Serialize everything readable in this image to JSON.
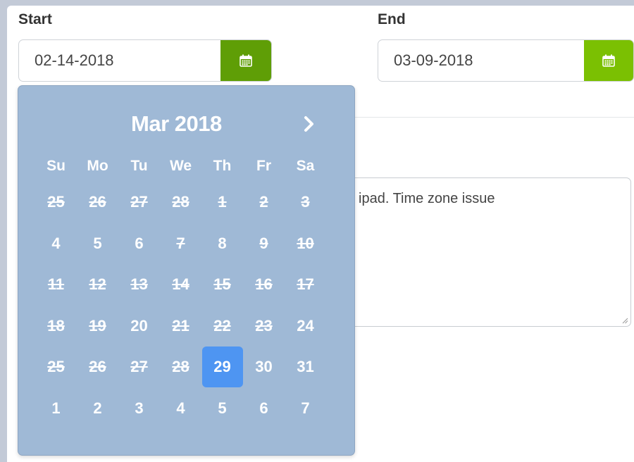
{
  "start": {
    "label": "Start",
    "value": "02-14-2018"
  },
  "end": {
    "label": "End",
    "value": "03-09-2018"
  },
  "notes": {
    "visible_text": "ipad. Time zone issue"
  },
  "datepicker": {
    "title": "Mar 2018",
    "weekdays": [
      "Su",
      "Mo",
      "Tu",
      "We",
      "Th",
      "Fr",
      "Sa"
    ],
    "weeks": [
      [
        {
          "d": "25",
          "disabled": true
        },
        {
          "d": "26",
          "disabled": true
        },
        {
          "d": "27",
          "disabled": true
        },
        {
          "d": "28",
          "disabled": true
        },
        {
          "d": "1",
          "disabled": true
        },
        {
          "d": "2",
          "disabled": true
        },
        {
          "d": "3",
          "disabled": true
        }
      ],
      [
        {
          "d": "4",
          "disabled": false
        },
        {
          "d": "5",
          "disabled": false
        },
        {
          "d": "6",
          "disabled": false
        },
        {
          "d": "7",
          "disabled": true
        },
        {
          "d": "8",
          "disabled": false
        },
        {
          "d": "9",
          "disabled": true
        },
        {
          "d": "10",
          "disabled": true
        }
      ],
      [
        {
          "d": "11",
          "disabled": true
        },
        {
          "d": "12",
          "disabled": true
        },
        {
          "d": "13",
          "disabled": true
        },
        {
          "d": "14",
          "disabled": true
        },
        {
          "d": "15",
          "disabled": true
        },
        {
          "d": "16",
          "disabled": true
        },
        {
          "d": "17",
          "disabled": true
        }
      ],
      [
        {
          "d": "18",
          "disabled": true
        },
        {
          "d": "19",
          "disabled": true
        },
        {
          "d": "20",
          "disabled": false
        },
        {
          "d": "21",
          "disabled": true
        },
        {
          "d": "22",
          "disabled": true
        },
        {
          "d": "23",
          "disabled": true
        },
        {
          "d": "24",
          "disabled": false
        }
      ],
      [
        {
          "d": "25",
          "disabled": true
        },
        {
          "d": "26",
          "disabled": true
        },
        {
          "d": "27",
          "disabled": true
        },
        {
          "d": "28",
          "disabled": true
        },
        {
          "d": "29",
          "disabled": false,
          "selected": true
        },
        {
          "d": "30",
          "disabled": false
        },
        {
          "d": "31",
          "disabled": false
        }
      ],
      [
        {
          "d": "1",
          "disabled": false
        },
        {
          "d": "2",
          "disabled": false
        },
        {
          "d": "3",
          "disabled": false
        },
        {
          "d": "4",
          "disabled": false
        },
        {
          "d": "5",
          "disabled": false
        },
        {
          "d": "6",
          "disabled": false
        },
        {
          "d": "7",
          "disabled": false
        }
      ]
    ]
  },
  "icons": {
    "calendar_button": "calendar-icon",
    "next_month": "chevron-right-icon",
    "resize": "resize-grip-icon"
  },
  "colors": {
    "calendar_button_start": "#5f9e06",
    "calendar_button_end": "#7bc002",
    "datepicker_bg": "#9fb9d6",
    "selected_day": "#4e95f2",
    "page_bg": "#c3cad7"
  }
}
